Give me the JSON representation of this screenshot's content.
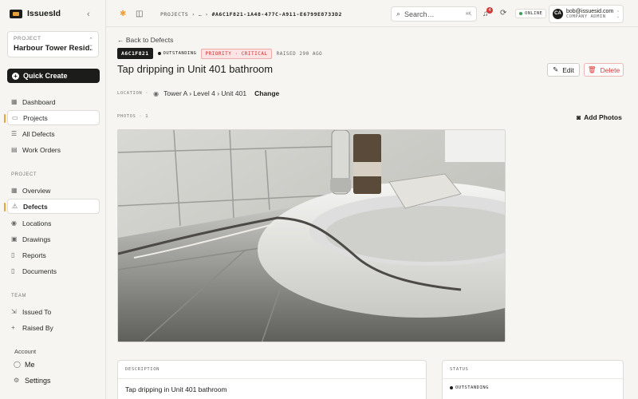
{
  "app": {
    "name": "IssuesId"
  },
  "sidebar": {
    "project_label": "PROJECT",
    "project_name": "Harbour Tower Resid...",
    "quick_create": "Quick Create",
    "main_items": [
      {
        "label": "Dashboard",
        "icon": "dashboard-icon"
      },
      {
        "label": "Projects",
        "icon": "folder-icon"
      },
      {
        "label": "All Defects",
        "icon": "list-icon"
      },
      {
        "label": "Work Orders",
        "icon": "clipboard-icon"
      }
    ],
    "project_section": "PROJECT",
    "project_items": [
      {
        "label": "Overview",
        "icon": "grid-icon"
      },
      {
        "label": "Defects",
        "icon": "alert-icon"
      },
      {
        "label": "Locations",
        "icon": "map-pin-icon"
      },
      {
        "label": "Drawings",
        "icon": "image-icon"
      },
      {
        "label": "Reports",
        "icon": "file-icon"
      },
      {
        "label": "Documents",
        "icon": "document-icon"
      }
    ],
    "team_section": "TEAM",
    "team_items": [
      {
        "label": "Issued To",
        "icon": "user-send-icon"
      },
      {
        "label": "Raised By",
        "icon": "user-plus-icon"
      }
    ],
    "account_section": "Account",
    "account_items": [
      {
        "label": "Me",
        "icon": "user-icon"
      },
      {
        "label": "Settings",
        "icon": "gear-icon"
      }
    ]
  },
  "topbar": {
    "crumb_projects": "PROJECTS",
    "crumb_sep": "›",
    "crumb_ellipsis": "…",
    "crumb_current": "#A6C1F821-1A48-477C-A911-E6799E8733D2",
    "search_placeholder": "Search…",
    "search_kbd": "⌘K",
    "notifications_count": "4",
    "online_label": "ONLINE",
    "user_initials": "CA",
    "user_email": "bob@issuesid.com",
    "user_role": "COMPANY ADMIN"
  },
  "defect": {
    "back_label": "Back to Defects",
    "id": "A6C1F821",
    "status": "OUTSTANDING",
    "priority": "PRIORITY · CRITICAL",
    "raised": "RAISED 290 AGO",
    "title": "Tap dripping in Unit 401 bathroom",
    "edit_label": "Edit",
    "delete_label": "Delete",
    "location_label": "LOCATION ·",
    "location_path": "Tower A › Level 4 › Unit 401",
    "change_label": "Change",
    "photos_label": "PHOTOS · 1",
    "add_photos_label": "Add Photos",
    "description_header": "DESCRIPTION",
    "description_text": "Tap dripping in Unit 401 bathroom",
    "status_header": "STATUS",
    "status_value": "OUTSTANDING"
  },
  "colors": {
    "accent": "#e9a23b",
    "danger": "#d43a3a",
    "online": "#3a9c55",
    "ink": "#1c1c1a"
  }
}
